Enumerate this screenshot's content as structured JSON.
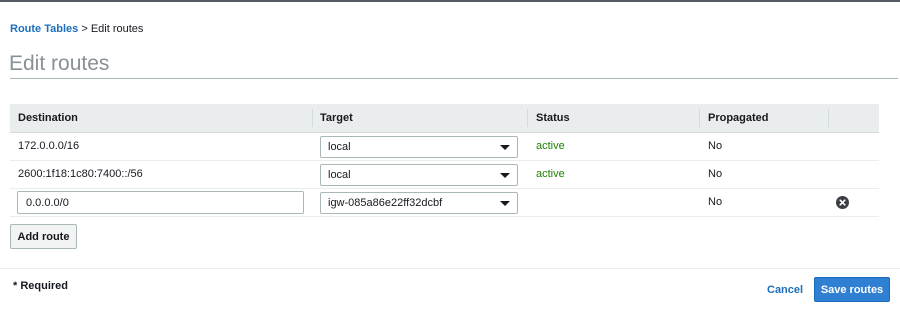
{
  "breadcrumb": {
    "parent": "Route Tables",
    "separator": ">",
    "current": "Edit routes"
  },
  "page_title": "Edit routes",
  "table": {
    "columns": [
      "Destination",
      "Target",
      "Status",
      "Propagated"
    ],
    "rows": [
      {
        "destination": "172.0.0.0/16",
        "target": "local",
        "status": "active",
        "propagated": "No",
        "editable": false
      },
      {
        "destination": "2600:1f18:1c80:7400::/56",
        "target": "local",
        "status": "active",
        "propagated": "No",
        "editable": false
      },
      {
        "destination": "0.0.0.0/0",
        "target": "igw-085a86e22ff32dcbf",
        "status": "",
        "propagated": "No",
        "editable": true
      }
    ]
  },
  "buttons": {
    "add_route": "Add route",
    "cancel": "Cancel",
    "save": "Save routes"
  },
  "required_note": "* Required",
  "icons": {
    "remove_row": "close-circle-icon",
    "dropdown": "caret-down-icon"
  },
  "colors": {
    "link": "#1b6fbd",
    "primary_button": "#2f7fd2",
    "status_active": "#1d8102",
    "header_bg": "#eaeded"
  }
}
